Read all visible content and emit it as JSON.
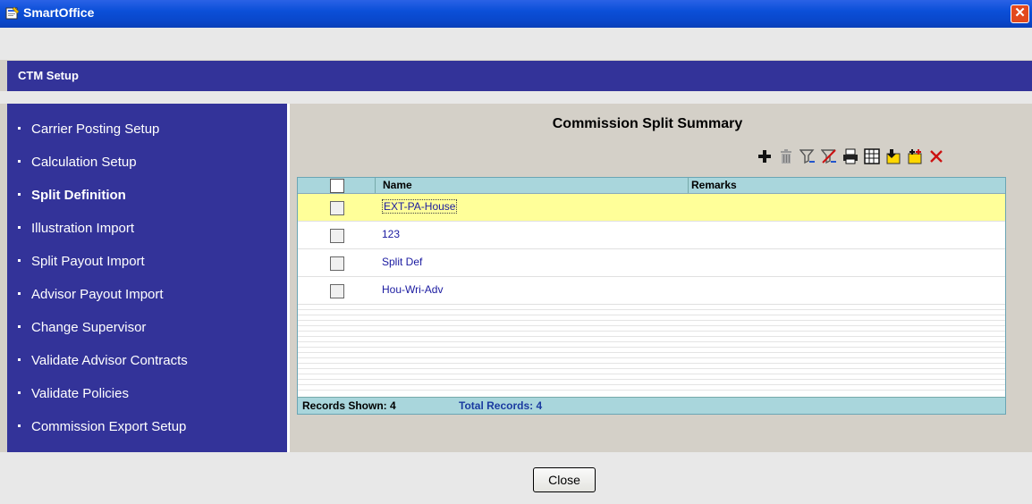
{
  "window": {
    "title": "SmartOffice",
    "close_glyph": "✕"
  },
  "header": {
    "title": "CTM Setup"
  },
  "sidebar": {
    "items": [
      {
        "label": "Carrier Posting Setup"
      },
      {
        "label": "Calculation Setup"
      },
      {
        "label": "Split Definition",
        "active": true
      },
      {
        "label": "Illustration Import"
      },
      {
        "label": "Split Payout Import"
      },
      {
        "label": "Advisor Payout Import"
      },
      {
        "label": "Change Supervisor"
      },
      {
        "label": "Validate Advisor Contracts"
      },
      {
        "label": "Validate Policies"
      },
      {
        "label": "Commission Export Setup"
      }
    ]
  },
  "main": {
    "title": "Commission Split Summary",
    "toolbar": [
      "add-icon",
      "delete-icon",
      "filter-icon",
      "clear-filter-icon",
      "print-icon",
      "columns-icon",
      "export-icon",
      "import-icon",
      "close-icon"
    ],
    "grid": {
      "columns": [
        "Name",
        "Remarks"
      ],
      "rows": [
        {
          "name": "EXT-PA-House",
          "remarks": "",
          "selected": true
        },
        {
          "name": "123",
          "remarks": ""
        },
        {
          "name": "Split Def",
          "remarks": ""
        },
        {
          "name": "Hou-Wri-Adv",
          "remarks": ""
        }
      ],
      "footer": {
        "shown": "Records Shown: 4",
        "total": "Total Records: 4"
      }
    }
  },
  "footer": {
    "close_label": "Close"
  },
  "colors": {
    "nav": "#333399",
    "grid_header": "#a9d6dc",
    "selected_row": "#ffff99",
    "titlebar": "#0a46c8"
  }
}
